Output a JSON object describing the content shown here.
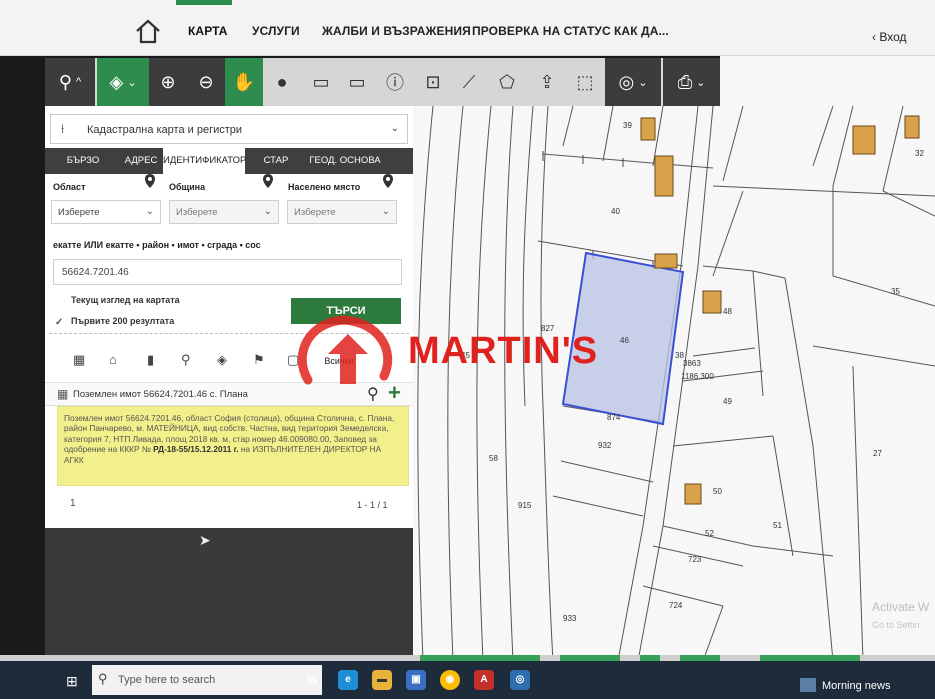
{
  "nav": {
    "items": [
      "КАРТА",
      "УСЛУГИ",
      "ЖАЛБИ И ВЪЗРАЖЕНИЯ",
      "ПРОВЕРКА НА СТАТУС",
      "КАК ДА..."
    ],
    "login": "Вход",
    "accent_color": "#2d8c4e"
  },
  "toolbar": {
    "tools": [
      "search-icon",
      "layers-icon",
      "zoom-in-icon",
      "zoom-out-icon",
      "hand-icon",
      "globe-icon",
      "select-rect-icon",
      "select-rect-minus-icon",
      "info-icon",
      "measure-area-icon",
      "ruler-icon",
      "polygon-icon",
      "upload-icon",
      "select-icon",
      "location-info-icon",
      "print-icon"
    ]
  },
  "panel": {
    "layer": "Кадастрална карта и регистри",
    "tabs": [
      "БЪРЗО ТЪРСЕНЕ",
      "АДРЕС",
      "ИДЕНТИФИКАТОР",
      "СТАР ИДЕНТ.",
      "ГЕОД. ОСНОВА"
    ],
    "active_tab": "ИДЕНТИФИКАТОР",
    "fields": {
      "oblast_label": "Област",
      "obshtina_label": "Община",
      "naseleno_label": "Населено място",
      "select_value": "Изберете",
      "ident_label": "екатте ИЛИ екатте • район • имот • сграда • сос",
      "ident_value": "56624.7201.46"
    },
    "checks": {
      "current_view": "Текущ изглед на картата",
      "first_200": "Първите 200 резултата"
    },
    "search_button": "ТЪРСИ",
    "all_button": "Всички",
    "result": {
      "title": "Поземлен имот 56624.7201.46 с. Плана",
      "text": "Поземлен имот 56624.7201.46, област София (столица), община Столична, с. Плана, район Панчарево, м. МАТЕЙНИЦА, вид собств. Частна, вид територия Земеделска, категория 7, НТП Ливада, площ 2018 кв. м, стар номер 46.009080.00,",
      "text_2": "Заповед за одобрение на КККР №",
      "order": "РД-18-55/15.12.2011 г.",
      "text_3": "на ИЗПЪЛНИТЕЛЕН ДИРЕКТОР НА АГКК",
      "page": "1",
      "range": "1 - 1 / 1"
    }
  },
  "map": {
    "labels": [
      "39",
      "40",
      "827",
      "46",
      "45",
      "874",
      "932",
      "58",
      "915",
      "933",
      "38",
      "48",
      "49",
      "50",
      "52",
      "51",
      "723",
      "724",
      "27",
      "35",
      "32",
      "1186.300",
      "3863"
    ]
  },
  "watermark": "MARTIN'S",
  "activate_windows": {
    "title": "Activate W",
    "sub": "Go to Settin"
  },
  "taskbar": {
    "search_placeholder": "Type here to search",
    "news": "Morning news"
  }
}
